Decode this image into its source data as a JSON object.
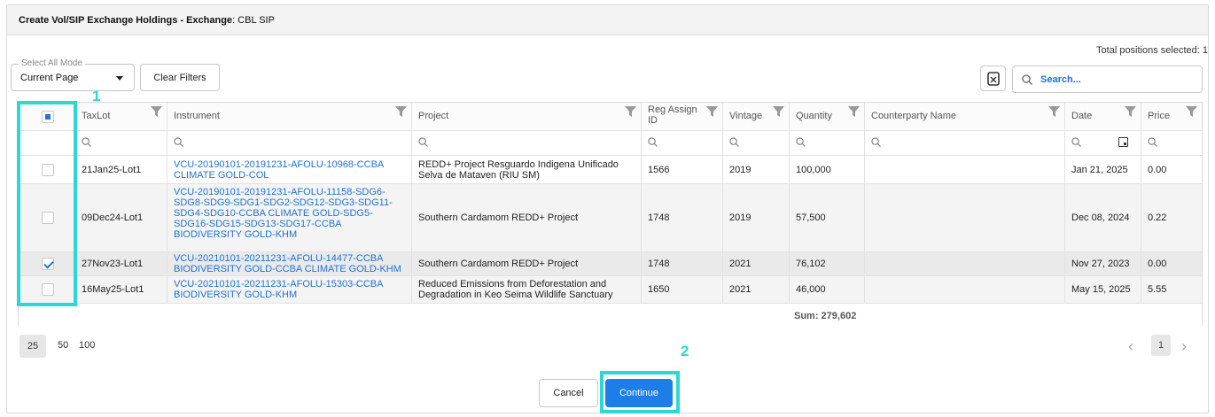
{
  "dialog": {
    "title_prefix": "Create Vol/SIP Exchange Holdings - Exchange",
    "title_suffix": ": CBL SIP"
  },
  "toolbar": {
    "total_selected": "Total positions selected: 1",
    "select_mode_label": "Select All Mode",
    "select_mode_value": "Current Page",
    "clear_filters": "Clear Filters",
    "search_placeholder": "Search..."
  },
  "table": {
    "columns": [
      "TaxLot",
      "Instrument",
      "Project",
      "Reg Assign ID",
      "Vintage",
      "Quantity",
      "Counterparty Name",
      "Date",
      "Price"
    ],
    "rows": [
      {
        "selected": false,
        "taxlot": "21Jan25-Lot1",
        "instrument": "VCU-20190101-20191231-AFOLU-10968-CCBA CLIMATE GOLD-COL",
        "project": "REDD+ Project Resguardo Indigena Unificado Selva de Mataven (RIU SM)",
        "reg_assign_id": "1566",
        "vintage": "2019",
        "quantity": "100,000",
        "counterparty": "",
        "date": "Jan 21, 2025",
        "price": "0.00"
      },
      {
        "selected": false,
        "taxlot": "09Dec24-Lot1",
        "instrument": "VCU-20190101-20191231-AFOLU-11158-SDG6-SDG8-SDG9-SDG1-SDG2-SDG12-SDG3-SDG11-SDG4-SDG10-CCBA CLIMATE GOLD-SDG5-SDG16-SDG15-SDG13-SDG17-CCBA BIODIVERSITY GOLD-KHM",
        "project": "Southern Cardamom REDD+ Project",
        "reg_assign_id": "1748",
        "vintage": "2019",
        "quantity": "57,500",
        "counterparty": "",
        "date": "Dec 08, 2024",
        "price": "0.22"
      },
      {
        "selected": true,
        "taxlot": "27Nov23-Lot1",
        "instrument": "VCU-20210101-20211231-AFOLU-14477-CCBA BIODIVERSITY GOLD-CCBA CLIMATE GOLD-KHM",
        "project": "Southern Cardamom REDD+ Project",
        "reg_assign_id": "1748",
        "vintage": "2021",
        "quantity": "76,102",
        "counterparty": "",
        "date": "Nov 27, 2023",
        "price": "0.00"
      },
      {
        "selected": false,
        "taxlot": "16May25-Lot1",
        "instrument": "VCU-20210101-20211231-AFOLU-15303-CCBA BIODIVERSITY GOLD-KHM",
        "project": "Reduced Emissions from Deforestation and Degradation in Keo Seima Wildlife Sanctuary",
        "reg_assign_id": "1650",
        "vintage": "2021",
        "quantity": "46,000",
        "counterparty": "",
        "date": "May 15, 2025",
        "price": "5.55"
      }
    ],
    "sum": "Sum: 279,602"
  },
  "pagination": {
    "page_sizes": [
      "25",
      "50",
      "100"
    ],
    "active_size": "25",
    "current_page": "1"
  },
  "actions": {
    "cancel": "Cancel",
    "continue": "Continue"
  },
  "annotations": {
    "step1": "1",
    "step2": "2",
    "highlight_color": "#2fd6d6"
  },
  "colors": {
    "link": "#1e73d8",
    "primary": "#1e7ee8"
  }
}
